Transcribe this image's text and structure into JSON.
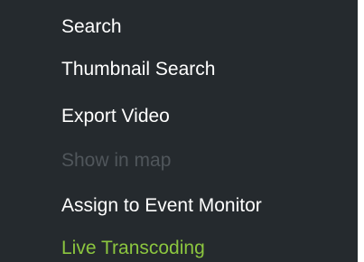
{
  "menu": {
    "items": [
      {
        "label": "Search",
        "state": "enabled"
      },
      {
        "label": "Thumbnail Search",
        "state": "enabled"
      },
      {
        "label": "Export Video",
        "state": "enabled"
      },
      {
        "label": "Show in map",
        "state": "disabled"
      },
      {
        "label": "Assign to Event Monitor",
        "state": "enabled"
      },
      {
        "label": "Live Transcoding",
        "state": "highlighted"
      }
    ]
  },
  "colors": {
    "menu_background": "#252a2e",
    "text_enabled": "#ffffff",
    "text_disabled": "#50565b",
    "text_highlight": "#8cc63f"
  }
}
